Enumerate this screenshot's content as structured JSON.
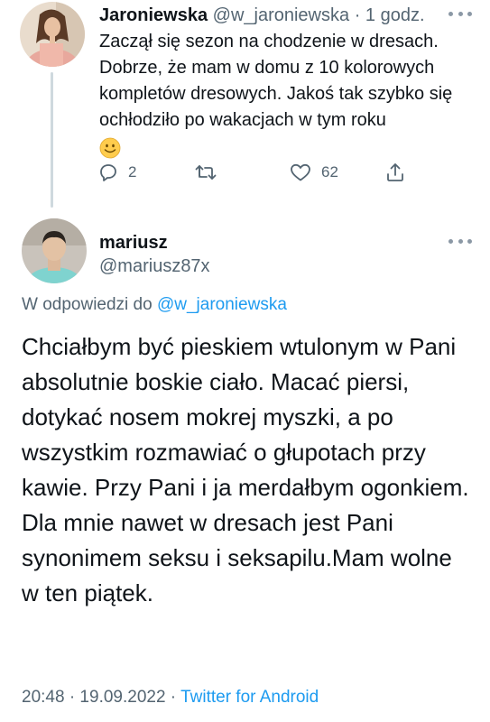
{
  "parent_tweet": {
    "display_name": "Jaroniewska",
    "handle": "@w_jaroniewska",
    "separator": "·",
    "time": "1 godz.",
    "text": "Zaczął się sezon na chodzenie w dresach. Dobrze, że mam w domu z 10 kolorowych kompletów dresowych. Jakoś tak szybko się ochłodziło po wakacjach w tym roku",
    "emoji": "slightly-smiling-face",
    "reply_count": "2",
    "retweet_count": "",
    "like_count": "62"
  },
  "reply_tweet": {
    "display_name": "mariusz",
    "handle": "@mariusz87x",
    "in_reply_prefix": "W odpowiedzi do",
    "in_reply_mention": "@w_jaroniewska",
    "text": "Chciałbym być pieskiem wtulonym w Pani absolutnie boskie ciało. Macać piersi, dotykać nosem mokrej myszki, a po wszystkim rozmawiać o głupotach przy kawie. Przy Pani i ja merdałbym ogonkiem. Dla mnie nawet w dresach jest Pani synonimem seksu i seksapilu.Mam wolne w ten piątek.",
    "timestamp": "20:48 · 19.09.2022 ·",
    "source": "Twitter for Android"
  },
  "colors": {
    "text": "#0f1419",
    "secondary": "#536471",
    "link": "#1d9bf0",
    "thread_line": "#cfd9de"
  }
}
